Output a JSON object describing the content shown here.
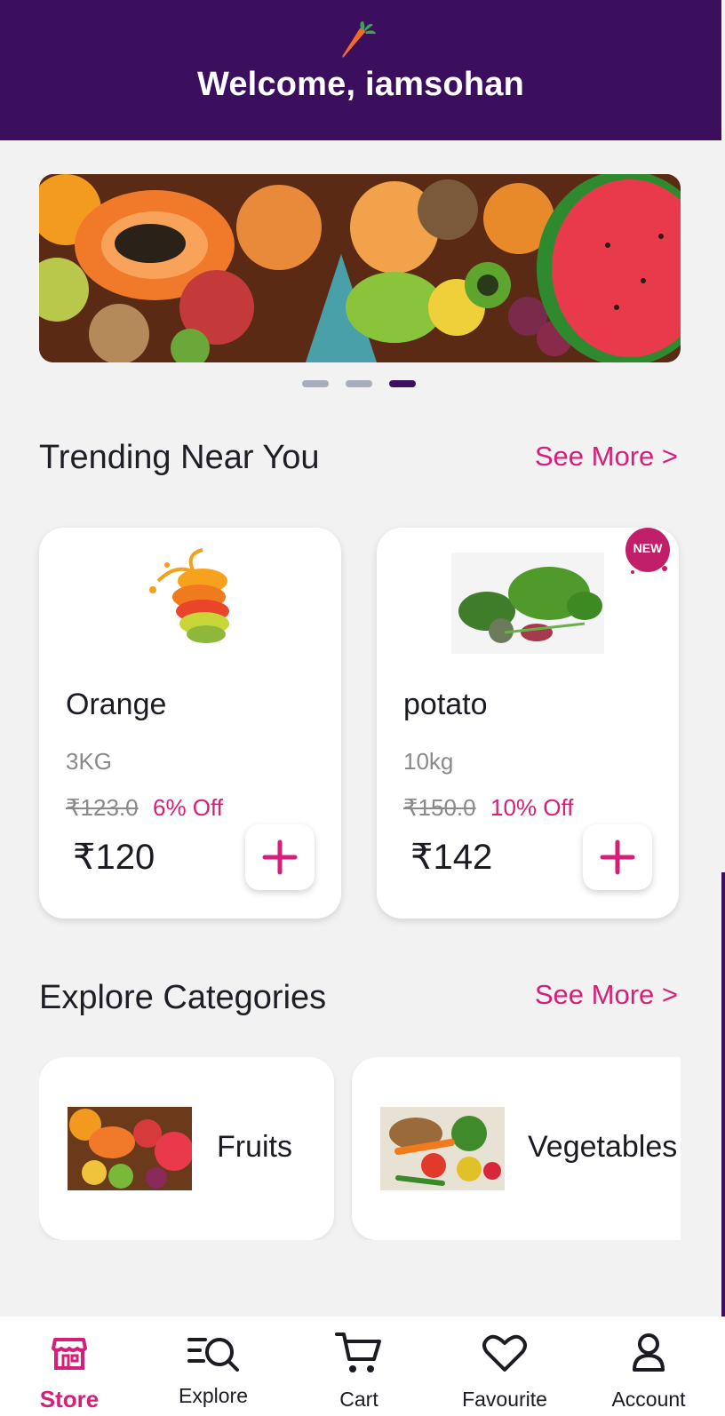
{
  "header": {
    "title": "Welcome, iamsohan",
    "logo_icon": "carrot-icon"
  },
  "banner": {
    "slide_count": 3,
    "active_slide": 3
  },
  "trending": {
    "title": "Trending Near You",
    "see_more": "See More >",
    "products": [
      {
        "name": "Orange",
        "qty": "3KG",
        "old_price": "₹123.0",
        "discount": "6% Off",
        "price": "₹120",
        "badge": ""
      },
      {
        "name": "potato",
        "qty": "10kg",
        "old_price": "₹150.0",
        "discount": "10% Off",
        "price": "₹142",
        "badge": "NEW"
      }
    ]
  },
  "categories": {
    "title": "Explore Categories",
    "see_more": "See More >",
    "items": [
      {
        "label": "Fruits"
      },
      {
        "label": "Vegetables"
      }
    ]
  },
  "nav": {
    "items": [
      {
        "label": "Store",
        "icon": "store-icon",
        "active": true
      },
      {
        "label": "Explore",
        "icon": "explore-icon",
        "active": false
      },
      {
        "label": "Cart",
        "icon": "cart-icon",
        "active": false
      },
      {
        "label": "Favourite",
        "icon": "heart-icon",
        "active": false
      },
      {
        "label": "Account",
        "icon": "account-icon",
        "active": false
      }
    ]
  },
  "colors": {
    "primary": "#3b0f5e",
    "accent": "#d61f78",
    "background": "#f2f2f2"
  }
}
